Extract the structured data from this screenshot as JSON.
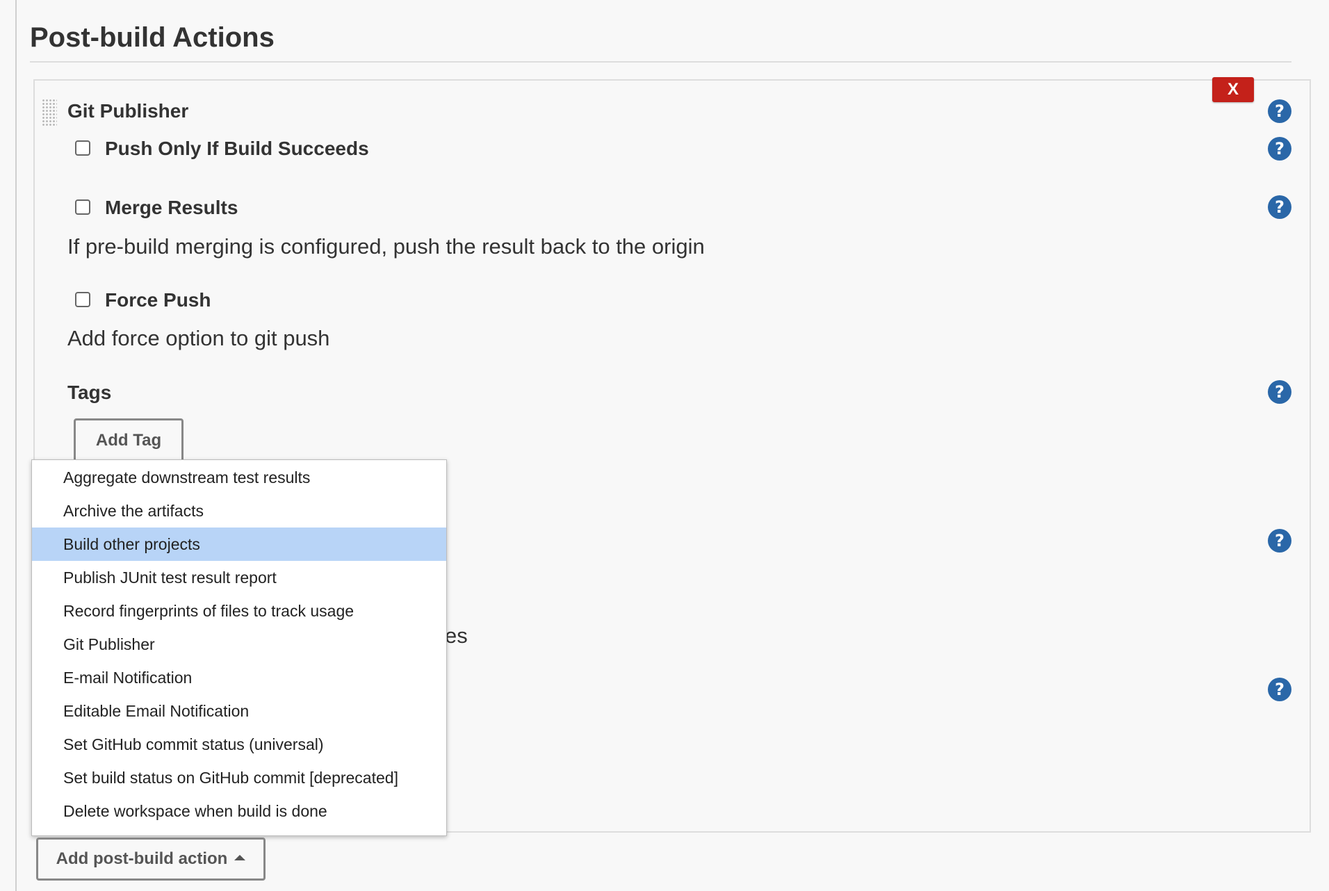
{
  "section": {
    "title": "Post-build Actions"
  },
  "publisher": {
    "title": "Git Publisher",
    "delete_label": "X",
    "options": [
      {
        "label": "Push Only If Build Succeeds",
        "checked": false
      },
      {
        "label": "Merge Results",
        "checked": false,
        "description": "If pre-build merging is configured, push the result back to the origin"
      },
      {
        "label": "Force Push",
        "checked": false,
        "description": "Add force option to git push"
      }
    ],
    "tags_label": "Tags",
    "add_tag_label": "Add Tag",
    "obscured_fragment": "es"
  },
  "help_icon_glyph": "?",
  "dropdown": {
    "items": [
      "Aggregate downstream test results",
      "Archive the artifacts",
      "Build other projects",
      "Publish JUnit test result report",
      "Record fingerprints of files to track usage",
      "Git Publisher",
      "E-mail Notification",
      "Editable Email Notification",
      "Set GitHub commit status (universal)",
      "Set build status on GitHub commit [deprecated]",
      "Delete workspace when build is done"
    ],
    "highlighted_item": "Build other projects"
  },
  "add_action_button": {
    "label": "Add post-build action",
    "icon": "caret-up-icon"
  },
  "colors": {
    "delete_button": "#c4211a",
    "help_icon": "#2a67a8",
    "menu_highlight": "#b8d4f7"
  }
}
